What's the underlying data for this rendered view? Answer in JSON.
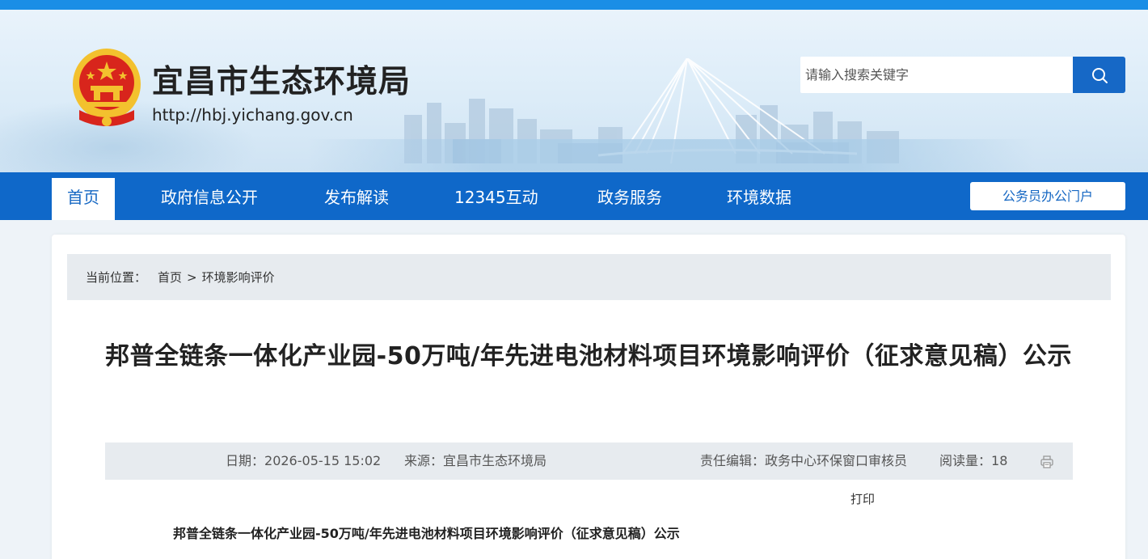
{
  "header": {
    "site_title": "宜昌市生态环境局",
    "site_url": "http://hbj.yichang.gov.cn",
    "search_placeholder": "请输入搜索关键字"
  },
  "nav": {
    "items": [
      {
        "label": "首页",
        "active": true
      },
      {
        "label": "政府信息公开"
      },
      {
        "label": "发布解读"
      },
      {
        "label": "12345互动"
      },
      {
        "label": "政务服务"
      },
      {
        "label": "环境数据"
      }
    ],
    "staff_portal": "公务员办公门户"
  },
  "breadcrumb": {
    "prefix": "当前位置：",
    "home": "首页",
    "separator": ">",
    "current": "环境影响评价"
  },
  "article": {
    "title": "邦普全链条一体化产业园-50万吨/年先进电池材料项目环境影响评价（征求意见稿）公示",
    "meta": {
      "date_label": "日期：",
      "date": "2026-05-15 15:02",
      "source_label": "来源：",
      "source": "宜昌市生态环境局",
      "editor_label": "责任编辑：",
      "editor": "政务中心环保窗口审核员",
      "views_label": "阅读量：",
      "views": "18"
    },
    "print_label": "打印",
    "subtitle": "邦普全链条一体化产业园-50万吨/年先进电池材料项目环境影响评价（征求意见稿）公示"
  },
  "colors": {
    "top_strip": "#1a8ee6",
    "nav_bg": "#0f68c9",
    "accent": "#1567c3",
    "search_button": "#1668c6",
    "meta_bg": "#e7ebef",
    "emblem_red": "#d8251c",
    "emblem_gold": "#f3c12e"
  },
  "icons": {
    "search": "search-icon",
    "print": "printer-icon",
    "emblem": "national-emblem-icon"
  }
}
